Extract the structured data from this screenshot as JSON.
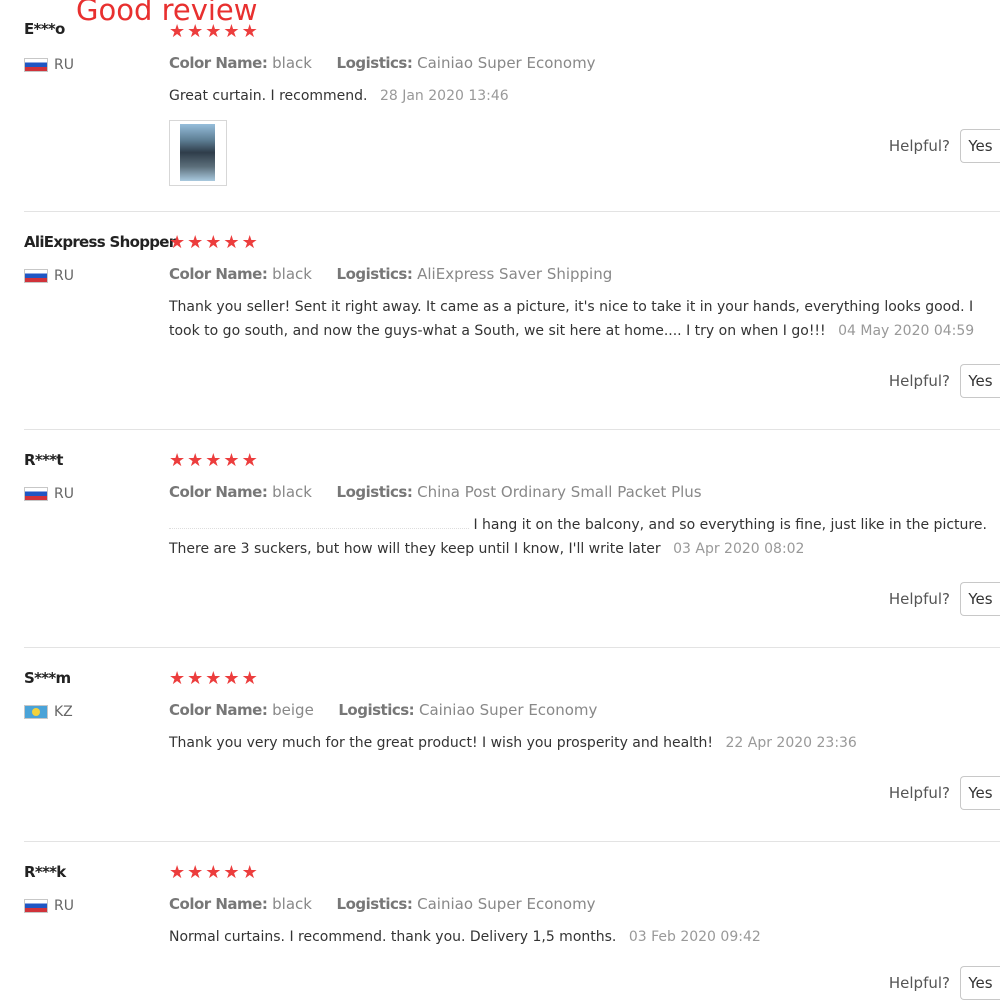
{
  "banner": {
    "title": "Good review"
  },
  "labels": {
    "color_name": "Color Name:",
    "logistics": "Logistics:",
    "helpful": "Helpful?",
    "yes": "Yes"
  },
  "star_rating_max": 5,
  "colors": {
    "banner_text": "#e8302f",
    "star": "#ec3d3d"
  },
  "reviews": [
    {
      "reviewer": "E***o",
      "country": "RU",
      "rating": 5,
      "color_name": "black",
      "logistics": "Cainiao Super Economy",
      "comment": "Great curtain. I recommend.",
      "date": "28 Jan 2020 13:46",
      "has_photo": true
    },
    {
      "reviewer": "AliExpress Shopper",
      "country": "RU",
      "rating": 5,
      "color_name": "black",
      "logistics": "AliExpress Saver Shipping",
      "comment": "Thank you seller! Sent it right away. It came as a picture, it's nice to take it in your hands, everything looks good. I took to go south, and now the guys-what a South, we sit here at home.... I try on when I go!!!",
      "date": "04 May 2020 04:59"
    },
    {
      "reviewer": "R***t",
      "country": "RU",
      "rating": 5,
      "color_name": "black",
      "logistics": "China Post Ordinary Small Packet Plus",
      "comment": "I hang it on the balcony, and so everything is fine, just like in the picture. There are 3 suckers, but how will they keep until I know, I'll write later",
      "date": "03 Apr 2020 08:02",
      "comment_partially_hidden": true
    },
    {
      "reviewer": "S***m",
      "country": "KZ",
      "rating": 5,
      "color_name": "beige",
      "logistics": "Cainiao Super Economy",
      "comment": "Thank you very much for the great product! I wish you prosperity and health!",
      "date": "22 Apr 2020 23:36"
    },
    {
      "reviewer": "R***k",
      "country": "RU",
      "rating": 5,
      "color_name": "black",
      "logistics": "Cainiao Super Economy",
      "comment": "Normal curtains. I recommend. thank you. Delivery 1,5 months.",
      "date": "03 Feb 2020 09:42"
    }
  ]
}
